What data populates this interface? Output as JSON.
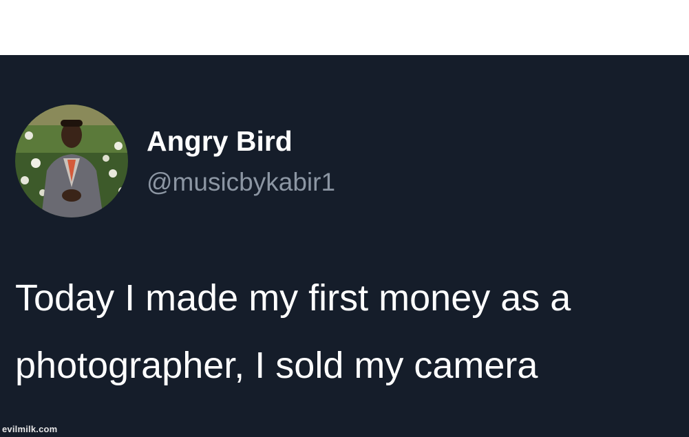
{
  "tweet": {
    "display_name": "Angry Bird",
    "handle": "@musicbykabir1",
    "text_lines": [
      "Today I made my first money as a",
      "photographer, I sold my camera"
    ]
  },
  "watermark": "evilmilk.com",
  "colors": {
    "card_background": "#151d2a",
    "name": "#ffffff",
    "handle": "#8c96a3",
    "text": "#ffffff",
    "page_background": "#ffffff"
  },
  "icons": {
    "avatar": "profile-photo"
  }
}
